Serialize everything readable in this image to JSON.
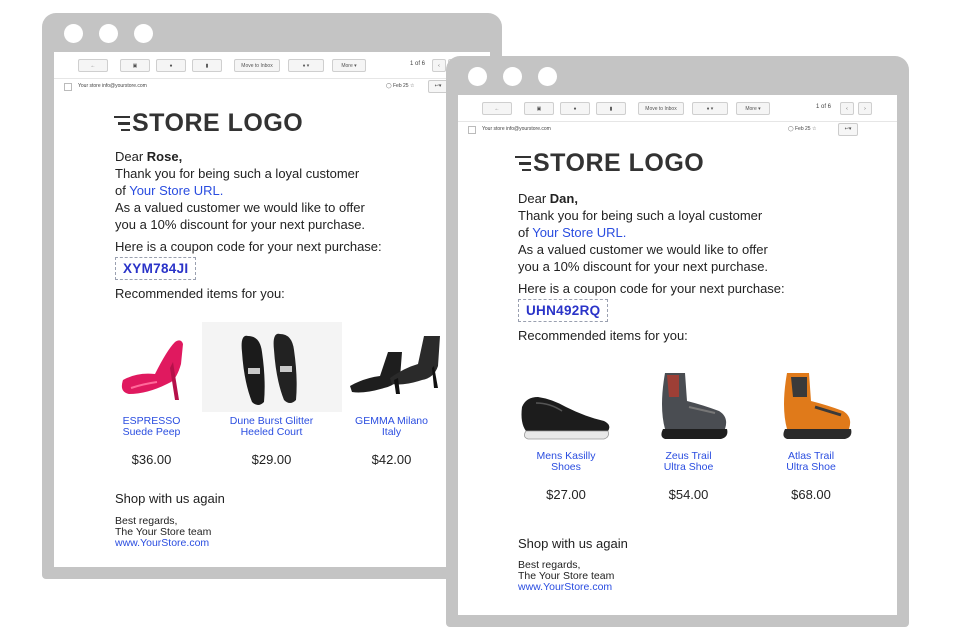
{
  "toolbar": {
    "move_to_inbox": "Move to Inbox",
    "more": "More",
    "pager": "1 of 6"
  },
  "email1": {
    "sender": "Your store info@yourstore.com",
    "date": "Feb 25",
    "logo": "STORE LOGO",
    "greeting_prefix": "Dear ",
    "customer": "Rose,",
    "line1": "Thank you for being such a loyal customer",
    "line2_prefix": "of ",
    "store_url": "Your Store URL.",
    "line3": "As a valued customer we would like to offer",
    "line4": "you a 10% discount for your next purchase.",
    "coupon_intro": "Here is a coupon code for your next purchase:",
    "coupon": "XYM784JI",
    "recommended": "Recommended items for you:",
    "products": [
      {
        "name_l1": "ESPRESSO",
        "name_l2": "Suede Peep",
        "price": "$36.00"
      },
      {
        "name_l1": "Dune Burst Glitter",
        "name_l2": "Heeled Court",
        "price": "$29.00"
      },
      {
        "name_l1": "GEMMA Milano",
        "name_l2": "Italy",
        "price": "$42.00"
      }
    ],
    "shop_again": "Shop with us again",
    "regards": "Best regards,",
    "team": "The Your Store team",
    "website": "www.YourStore.com"
  },
  "email2": {
    "sender": "Your store info@yourstore.com",
    "date": "Feb 25",
    "logo": "STORE LOGO",
    "greeting_prefix": "Dear ",
    "customer": "Dan,",
    "line1": "Thank you for being such a loyal customer",
    "line2_prefix": "of ",
    "store_url": "Your Store URL.",
    "line3": "As a valued customer we would like to offer",
    "line4": "you a 10% discount for your next purchase.",
    "coupon_intro": "Here is a coupon code for your next purchase:",
    "coupon": "UHN492RQ",
    "recommended": "Recommended items for you:",
    "products": [
      {
        "name_l1": "Mens Kasilly",
        "name_l2": "Shoes",
        "price": "$27.00"
      },
      {
        "name_l1": "Zeus Trail",
        "name_l2": "Ultra Shoe",
        "price": "$54.00"
      },
      {
        "name_l1": "Atlas Trail",
        "name_l2": "Ultra Shoe",
        "price": "$68.00"
      }
    ],
    "shop_again": "Shop with us again",
    "regards": "Best regards,",
    "team": "The Your Store team",
    "website": "www.YourStore.com"
  },
  "colors": {
    "frame": "#c4c4c4",
    "link": "#2a4de0",
    "coupon": "#2a33c8"
  }
}
